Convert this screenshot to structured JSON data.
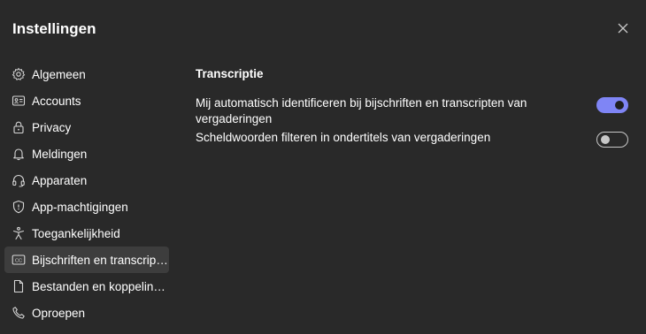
{
  "dialog": {
    "title": "Instellingen"
  },
  "icons": {
    "close": "close-icon"
  },
  "sidebar": {
    "items": [
      {
        "label": "Algemeen",
        "icon": "gear-icon",
        "active": false
      },
      {
        "label": "Accounts",
        "icon": "id-card-icon",
        "active": false
      },
      {
        "label": "Privacy",
        "icon": "lock-icon",
        "active": false
      },
      {
        "label": "Meldingen",
        "icon": "bell-icon",
        "active": false
      },
      {
        "label": "Apparaten",
        "icon": "headset-icon",
        "active": false
      },
      {
        "label": "App-machtigingen",
        "icon": "shield-icon",
        "active": false
      },
      {
        "label": "Toegankelijkheid",
        "icon": "accessibility-icon",
        "active": false
      },
      {
        "label": "Bijschriften en transcript...",
        "icon": "closed-captions-icon",
        "active": true
      },
      {
        "label": "Bestanden en koppeling...",
        "icon": "document-icon",
        "active": false
      },
      {
        "label": "Oproepen",
        "icon": "phone-icon",
        "active": false
      }
    ]
  },
  "content": {
    "section_title": "Transcriptie",
    "settings": [
      {
        "label": "Mij automatisch identificeren bij bijschriften en transcripten van vergaderingen",
        "enabled": true
      },
      {
        "label": "Scheldwoorden filteren in ondertitels van vergaderingen",
        "enabled": false
      }
    ]
  },
  "colors": {
    "background": "#292929",
    "active_item": "#3d3d3d",
    "toggle_on": "#7f85f5",
    "text": "#ffffff"
  }
}
